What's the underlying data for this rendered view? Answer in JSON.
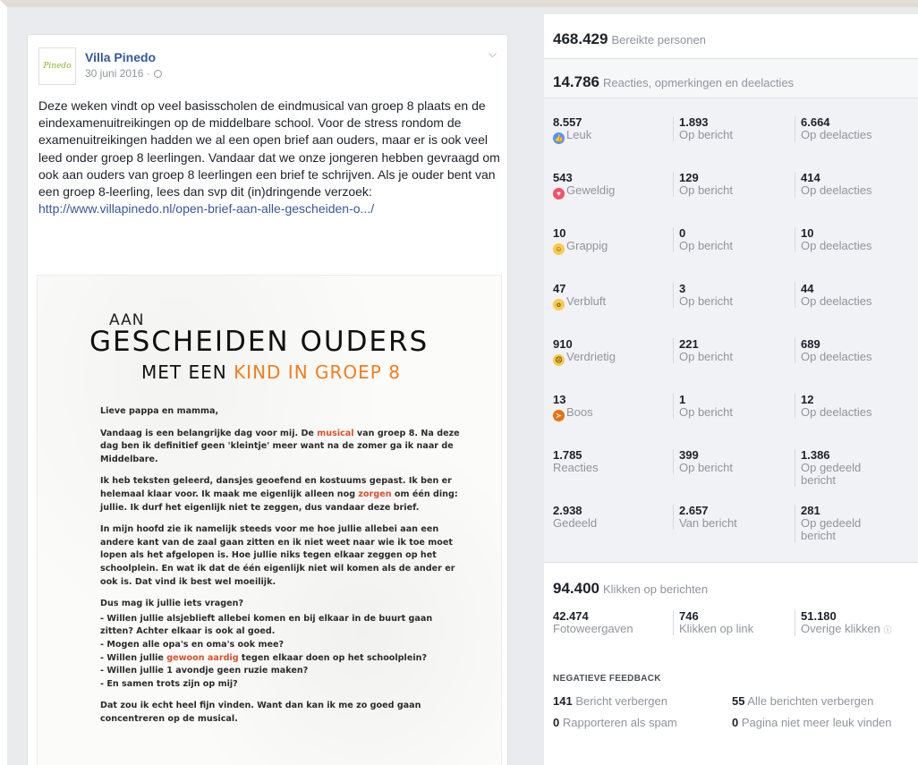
{
  "post": {
    "page_name": "Villa Pinedo",
    "date": "30 juni 2016 ·",
    "body": "Deze weken vindt op veel basisscholen de eindmusical van groep 8 plaats en de eindexamenuitreikingen op de middelbare school. Voor de stress rondom de examenuitreikingen hadden we al een open brief aan ouders, maar er is ook veel leed onder groep 8 leerlingen. Vandaar dat we onze jongeren hebben gevraagd om ook aan ouders van groep 8 leerlingen een brief te schrijven. Als je ouder bent van een groep 8-leerling, lees dan svp dit (in)dringende verzoek:",
    "link": "http://www.villapinedo.nl/open-brief-aan-alle-gescheiden-o.../",
    "avatar_text": "Pinedo"
  },
  "letter": {
    "aan": "AAN",
    "title": "GESCHEIDEN OUDERS",
    "sub_a": "MET EEN ",
    "sub_b": "KIND IN GROEP 8",
    "p1": "Lieve pappa en mamma,",
    "p2a": "Vandaag is een belangrijke dag voor mij. De ",
    "p2b": "musical",
    "p2c": " van groep 8. Na deze dag ben ik definitief geen 'kleintje' meer want na de zomer ga ik naar de Middelbare.",
    "p3a": "Ik heb teksten geleerd, dansjes geoefend en kostuums gepast. Ik ben er helemaal klaar voor. Ik maak me eigenlijk alleen nog ",
    "p3b": "zorgen",
    "p3c": " om één ding: jullie. Ik durf het eigenlijk niet te zeggen, dus vandaar deze brief.",
    "p4": "In mijn hoofd zie ik namelijk steeds voor me hoe jullie allebei aan een andere kant van de zaal gaan zitten en ik niet weet naar wie ik toe moet lopen als het afgelopen is. Hoe jullie niks tegen elkaar zeggen op het schoolplein. En wat ik dat de één eigenlijk niet wil komen als de ander er ook is. Dat vind ik best wel moeilijk.",
    "p5": "Dus mag ik jullie iets vragen?",
    "li1": "Willen jullie alsjeblieft allebei komen en bij elkaar in de buurt gaan zitten? Achter elkaar is ook al goed.",
    "li2": "Mogen alle opa's en oma's ook mee?",
    "li3a": "Willen jullie ",
    "li3b": "gewoon aardig",
    "li3c": " tegen elkaar doen op het schoolplein?",
    "li4": "Willen jullie 1 avondje geen ruzie maken?",
    "li5": "En samen trots zijn op mij?",
    "p6": "Dat zou ik echt heel fijn vinden. Want dan kan ik me zo goed gaan concentreren op de musical."
  },
  "insights": {
    "reach_value": "468.429",
    "reach_label": "Bereikte personen",
    "engage_value": "14.786",
    "engage_label": "Reacties, opmerkingen en deelacties",
    "rows": [
      {
        "v1": "8.557",
        "l1": "Leuk",
        "icon": "like-icon",
        "v2": "1.893",
        "l2": "Op bericht",
        "v3": "6.664",
        "l3": "Op deelacties"
      },
      {
        "v1": "543",
        "l1": "Geweldig",
        "icon": "love-icon",
        "v2": "129",
        "l2": "Op bericht",
        "v3": "414",
        "l3": "Op deelacties"
      },
      {
        "v1": "10",
        "l1": "Grappig",
        "icon": "haha-icon",
        "v2": "0",
        "l2": "Op bericht",
        "v3": "10",
        "l3": "Op deelacties"
      },
      {
        "v1": "47",
        "l1": "Verbluft",
        "icon": "wow-icon",
        "v2": "3",
        "l2": "Op bericht",
        "v3": "44",
        "l3": "Op deelacties"
      },
      {
        "v1": "910",
        "l1": "Verdrietig",
        "icon": "sad-icon",
        "v2": "221",
        "l2": "Op bericht",
        "v3": "689",
        "l3": "Op deelacties"
      },
      {
        "v1": "13",
        "l1": "Boos",
        "icon": "angry-icon",
        "v2": "1",
        "l2": "Op bericht",
        "v3": "12",
        "l3": "Op deelacties"
      },
      {
        "v1": "1.785",
        "l1": "Reacties",
        "v2": "399",
        "l2": "Op bericht",
        "v3": "1.386",
        "l3": "Op gedeeld bericht"
      },
      {
        "v1": "2.938",
        "l1": "Gedeeld",
        "v2": "2.657",
        "l2": "Van bericht",
        "v3": "281",
        "l3": "Op gedeeld bericht"
      }
    ],
    "clicks_value": "94.400",
    "clicks_label": "Klikken op berichten",
    "clicks": {
      "v1": "42.474",
      "l1": "Fotoweergaven",
      "v2": "746",
      "l2": "Klikken op link",
      "v3": "51.180",
      "l3": "Overige klikken"
    },
    "neg_header": "NEGATIEVE FEEDBACK",
    "neg": [
      {
        "v": "141",
        "l": "Bericht verbergen"
      },
      {
        "v": "55",
        "l": "Alle berichten verbergen"
      },
      {
        "v": "0",
        "l": "Rapporteren als spam"
      },
      {
        "v": "0",
        "l": "Pagina niet meer leuk vinden"
      }
    ]
  }
}
